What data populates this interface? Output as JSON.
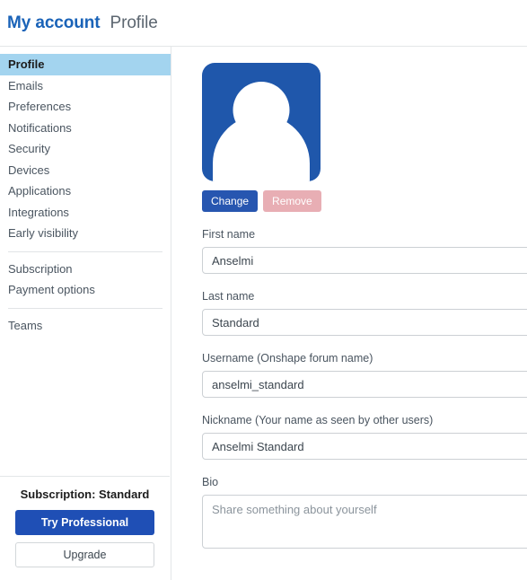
{
  "header": {
    "account_title": "My account",
    "page_title": "Profile"
  },
  "sidebar": {
    "group_main": [
      {
        "label": "Profile",
        "active": true
      },
      {
        "label": "Emails",
        "active": false
      },
      {
        "label": "Preferences",
        "active": false
      },
      {
        "label": "Notifications",
        "active": false
      },
      {
        "label": "Security",
        "active": false
      },
      {
        "label": "Devices",
        "active": false
      },
      {
        "label": "Applications",
        "active": false
      },
      {
        "label": "Integrations",
        "active": false
      },
      {
        "label": "Early visibility",
        "active": false
      }
    ],
    "group_billing": [
      {
        "label": "Subscription"
      },
      {
        "label": "Payment options"
      }
    ],
    "group_teams": [
      {
        "label": "Teams"
      }
    ],
    "footer": {
      "subscription_text": "Subscription: Standard",
      "try_professional_label": "Try Professional",
      "upgrade_label": "Upgrade"
    }
  },
  "main": {
    "avatar_icon": "user-avatar-icon",
    "change_label": "Change",
    "remove_label": "Remove",
    "fields": {
      "first_name": {
        "label": "First name",
        "value": "Anselmi",
        "placeholder": ""
      },
      "last_name": {
        "label": "Last name",
        "value": "Standard",
        "placeholder": ""
      },
      "username": {
        "label": "Username (Onshape forum name)",
        "value": "anselmi_standard",
        "placeholder": ""
      },
      "nickname": {
        "label": "Nickname (Your name as seen by other users)",
        "value": "Anselmi Standard",
        "placeholder": ""
      },
      "bio": {
        "label": "Bio",
        "value": "",
        "placeholder": "Share something about yourself"
      }
    }
  },
  "colors": {
    "brand_blue": "#1a63b8",
    "primary_button": "#1f4fb5",
    "active_nav": "#a3d4ef",
    "avatar_blue": "#1f57ab",
    "remove_pink": "#e8aeb4"
  }
}
